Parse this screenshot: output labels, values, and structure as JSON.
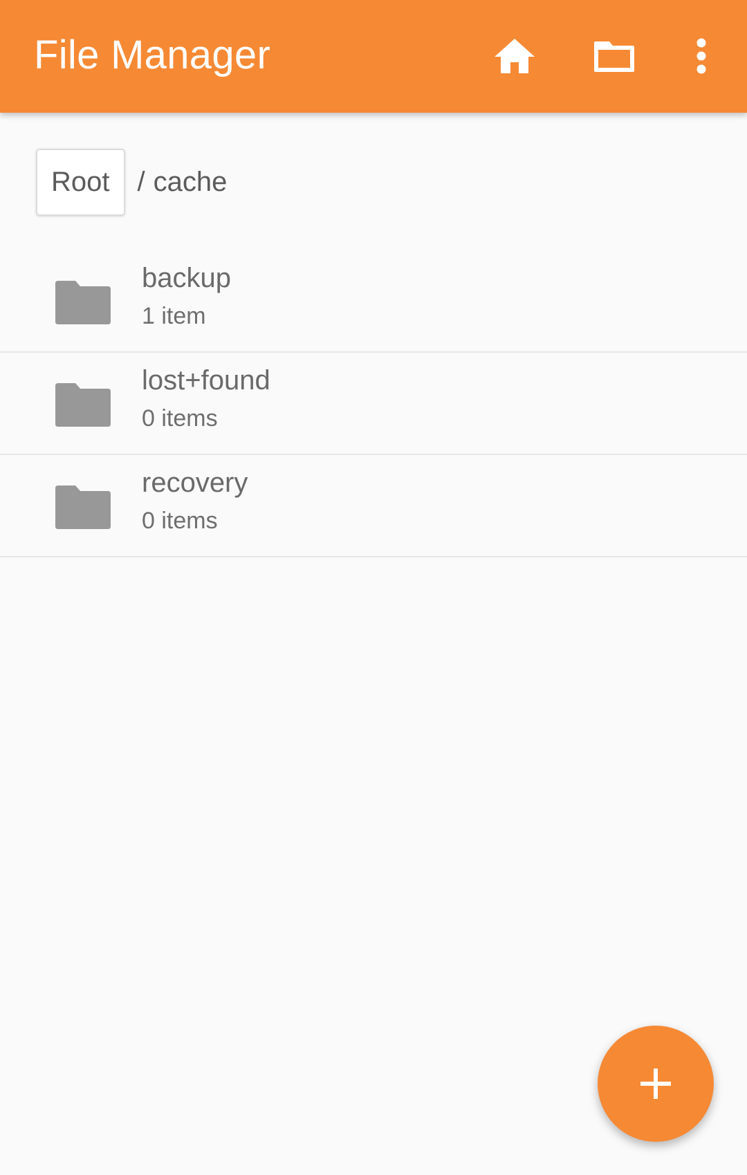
{
  "appbar": {
    "title": "File Manager",
    "actions": [
      {
        "icon": "home-icon"
      },
      {
        "icon": "folder-icon"
      },
      {
        "icon": "more-vert-icon"
      }
    ]
  },
  "breadcrumb": {
    "root_label": "Root",
    "separator": "/",
    "current": "cache"
  },
  "list": {
    "items": [
      {
        "name": "backup",
        "count": "1 item",
        "icon": "folder-icon"
      },
      {
        "name": "lost+found",
        "count": "0 items",
        "icon": "folder-icon"
      },
      {
        "name": "recovery",
        "count": "0 items",
        "icon": "folder-icon"
      }
    ]
  },
  "fab": {
    "icon": "add-icon"
  },
  "colors": {
    "accent": "#f68934",
    "background": "#fafafa",
    "folder_icon": "#989898",
    "text": "#6a6a6a"
  }
}
